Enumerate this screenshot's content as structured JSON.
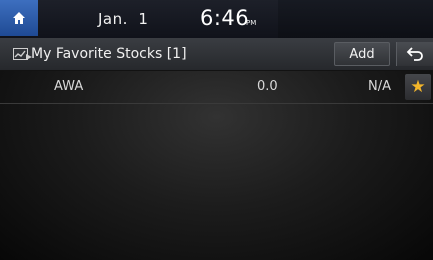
{
  "status_bar": {
    "home_icon": "home-icon",
    "date": "Jan.  1",
    "time": "6:46",
    "ampm": "PM"
  },
  "header": {
    "icon": "stocks-chart-icon",
    "title": "My Favorite Stocks [1]",
    "add_label": "Add",
    "back_icon": "back-arrow-icon"
  },
  "stocks": [
    {
      "symbol": "AWA",
      "price": "0.0",
      "change": "N/A",
      "favorite_icon": "star-icon"
    }
  ],
  "colors": {
    "home_button": "#2f5eac",
    "star": "#f3b52a",
    "header_bg": "#33363b"
  }
}
